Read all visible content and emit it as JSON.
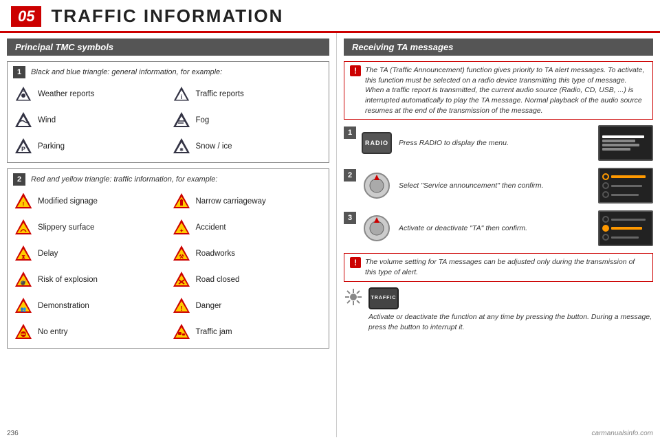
{
  "header": {
    "number": "05",
    "title": "TRAFFIC INFORMATION"
  },
  "left": {
    "section_title": "Principal TMC symbols",
    "box1": {
      "number": "1",
      "description": "Black and blue triangle: general information, for example:"
    },
    "general_symbols": [
      {
        "label": "Weather reports",
        "col": 1,
        "icon": "weather"
      },
      {
        "label": "Traffic reports",
        "col": 2,
        "icon": "traffic"
      },
      {
        "label": "Wind",
        "col": 1,
        "icon": "wind"
      },
      {
        "label": "Fog",
        "col": 2,
        "icon": "fog"
      },
      {
        "label": "Parking",
        "col": 1,
        "icon": "parking"
      },
      {
        "label": "Snow / ice",
        "col": 2,
        "icon": "snow"
      }
    ],
    "box2": {
      "number": "2",
      "description": "Red and yellow triangle: traffic information, for example:"
    },
    "traffic_symbols": [
      {
        "label": "Modified signage",
        "col": 1,
        "icon": "modified-signage"
      },
      {
        "label": "Narrow carriageway",
        "col": 2,
        "icon": "narrow-carriageway"
      },
      {
        "label": "Slippery surface",
        "col": 1,
        "icon": "slippery"
      },
      {
        "label": "Accident",
        "col": 2,
        "icon": "accident"
      },
      {
        "label": "Delay",
        "col": 1,
        "icon": "delay"
      },
      {
        "label": "Roadworks",
        "col": 2,
        "icon": "roadworks"
      },
      {
        "label": "Risk of explosion",
        "col": 1,
        "icon": "explosion"
      },
      {
        "label": "Road closed",
        "col": 2,
        "icon": "road-closed"
      },
      {
        "label": "Demonstration",
        "col": 1,
        "icon": "demonstration"
      },
      {
        "label": "Danger",
        "col": 2,
        "icon": "danger"
      },
      {
        "label": "No entry",
        "col": 1,
        "icon": "no-entry"
      },
      {
        "label": "Traffic jam",
        "col": 2,
        "icon": "traffic-jam"
      }
    ]
  },
  "right": {
    "section_title": "Receiving TA messages",
    "intro_text": "The TA (Traffic Announcement) function gives priority to TA alert messages. To activate, this function must be selected on a radio device transmitting this type of message. When a traffic report is transmitted, the current audio source (Radio, CD, USB, ...) is interrupted automatically to play the TA message. Normal playback of the audio source resumes at the end of the transmission of the message.",
    "steps": [
      {
        "number": "1",
        "text": "Press RADIO to display the menu.",
        "button": "RADIO"
      },
      {
        "number": "2",
        "text": "Select \"Service announcement\" then confirm.",
        "button": "dial"
      },
      {
        "number": "3",
        "text": "Activate or deactivate \"TA\" then confirm.",
        "button": "dial-select"
      }
    ],
    "warning1": "The volume setting for TA messages can be adjusted only during the transmission of this type of alert.",
    "footer_note": "Activate or deactivate the function at any time by pressing the button. During a message, press the button to interrupt it.",
    "traffic_label": "TRAFFIC"
  },
  "page_number": "236",
  "watermark": "carmanualsinfo.com"
}
